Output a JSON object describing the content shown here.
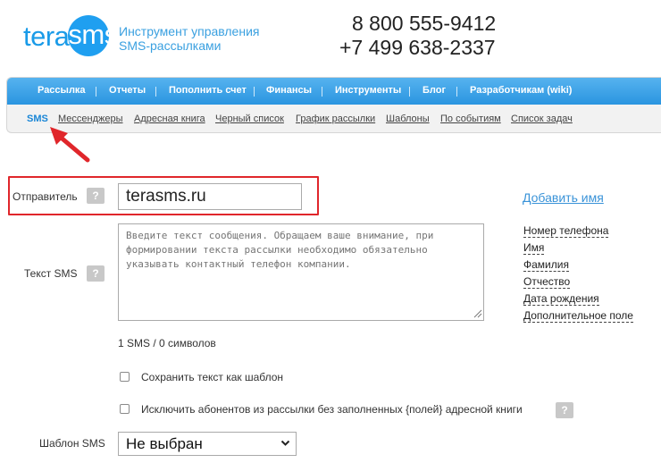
{
  "header": {
    "logo_part1": "tera",
    "logo_part2": "sms",
    "tagline_line1": "Инструмент управления",
    "tagline_line2": "SMS-рассылками",
    "phone1": "8 800 555-9412",
    "phone2": "+7 499 638-2337"
  },
  "nav": {
    "items": [
      "Рассылка",
      "Отчеты",
      "Пополнить счет",
      "Финансы",
      "Инструменты",
      "Блог",
      "Разработчикам (wiki)"
    ],
    "sub_items": [
      "SMS",
      "Мессенджеры",
      "Адресная книга",
      "Черный список",
      "График рассылки",
      "Шаблоны",
      "По событиям",
      "Список задач"
    ],
    "active_sub": "SMS"
  },
  "form": {
    "sender_label": "Отправитель",
    "sender_value": "terasms.ru",
    "help_symbol": "?",
    "text_label": "Текст SMS",
    "text_placeholder": "Введите текст сообщения. Обращаем ваше внимание, при формировании текста рассылки необходимо обязательно указывать контактный телефон компании.",
    "add_name": "Добавить имя",
    "fields": [
      "Номер телефона",
      "Имя",
      "Фамилия",
      "Отчество",
      "Дата рождения",
      "Дополнительное поле"
    ],
    "counter": "1 SMS / 0 символов",
    "save_template": "Сохранить текст как шаблон",
    "exclude_subscribers": "Исключить абонентов из рассылки без заполненных {полей} адресной книги",
    "template_label": "Шаблон SMS",
    "template_value": "Не выбран"
  },
  "colors": {
    "brand": "#1f9ff0",
    "nav_bar": "#2a95e0",
    "highlight": "#e0262b",
    "link": "#3a93d8"
  }
}
